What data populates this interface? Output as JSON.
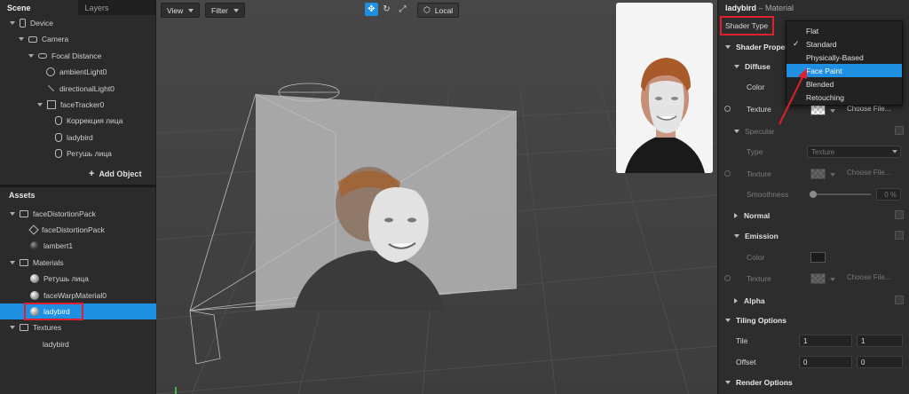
{
  "left_panel": {
    "tabs": [
      {
        "label": "Scene"
      },
      {
        "label": "Layers"
      }
    ],
    "scene_tree": [
      {
        "label": "Device"
      },
      {
        "label": "Camera"
      },
      {
        "label": "Focal Distance"
      },
      {
        "label": "ambientLight0"
      },
      {
        "label": "directionalLight0"
      },
      {
        "label": "faceTracker0"
      },
      {
        "label": "Коррекция лица"
      },
      {
        "label": "ladybird"
      },
      {
        "label": "Ретушь лица"
      }
    ],
    "add_object_label": "Add Object",
    "assets_title": "Assets",
    "assets_tree": [
      {
        "label": "faceDistortionPack"
      },
      {
        "label": "faceDistortionPack"
      },
      {
        "label": "lambert1"
      },
      {
        "label": "Materials"
      },
      {
        "label": "Ретушь лица"
      },
      {
        "label": "faceWarpMaterial0"
      },
      {
        "label": "ladybird"
      },
      {
        "label": "Textures"
      },
      {
        "label": "ladybird"
      }
    ]
  },
  "viewport": {
    "view_label": "View",
    "filter_label": "Filter",
    "local_label": "Local"
  },
  "right_panel": {
    "object_name": "ladybird",
    "object_type": "– Material",
    "shader_type_label": "Shader Type",
    "shader_properties_label": "Shader Propert",
    "diffuse_label": "Diffuse",
    "color_label": "Color",
    "texture_label": "Texture",
    "choose_file_label": "Choose File...",
    "specular_label": "Specular",
    "type_label": "Type",
    "type_value": "Texture",
    "smoothness_label": "Smoothness",
    "smoothness_value": "0",
    "smoothness_unit": "%",
    "normal_label": "Normal",
    "emission_label": "Emission",
    "alpha_label": "Alpha",
    "tiling_label": "Tiling Options",
    "tile_label": "Tile",
    "tile_x": "1",
    "tile_y": "1",
    "offset_label": "Offset",
    "offset_x": "0",
    "offset_y": "0",
    "render_options_label": "Render Options"
  },
  "shader_menu": {
    "options": [
      "Flat",
      "Standard",
      "Physically-Based",
      "Face Paint",
      "Blended",
      "Retouching"
    ],
    "checked": "Standard",
    "highlighted": "Face Paint"
  },
  "colors": {
    "accent": "#1e8fe1",
    "annotation_red": "#e0202f"
  }
}
